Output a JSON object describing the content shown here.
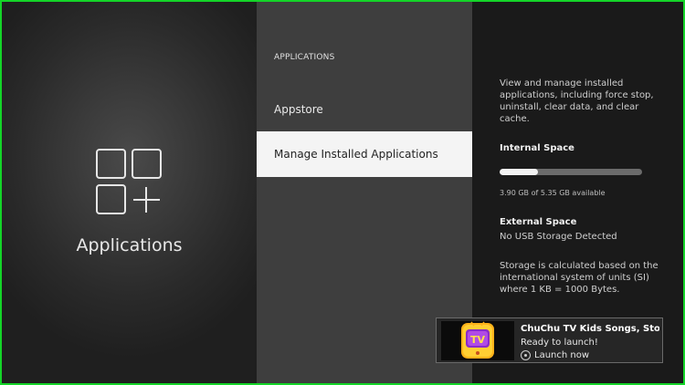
{
  "left_pane": {
    "icon": "apps-grid-plus-icon",
    "title": "Applications"
  },
  "middle_pane": {
    "section_header": "APPLICATIONS",
    "items": [
      {
        "label": "Appstore",
        "selected": false
      },
      {
        "label": "Manage Installed Applications",
        "selected": true
      }
    ]
  },
  "right_pane": {
    "description": "View and manage installed applications, including force stop, uninstall, clear data, and clear cache.",
    "internal_space": {
      "label": "Internal Space",
      "used_fraction": 0.27,
      "available_text": "3.90 GB of 5.35 GB available"
    },
    "external_space": {
      "label": "External Space",
      "value": "No USB Storage Detected"
    },
    "note": "Storage is calculated based on the international system of units (SI) where 1 KB = 1000 Bytes."
  },
  "toast": {
    "thumbnail_icon": "chuchu-tv-app-icon",
    "title": "ChuChu TV Kids Songs, Stories",
    "status": "Ready to launch!",
    "action_icon": "select-button-icon",
    "action_label": "Launch now"
  },
  "colors": {
    "frame_border": "#14d428",
    "selected_item_bg": "#f4f4f4",
    "middle_bg": "#3e3e3e",
    "right_bg": "#1a1a1a"
  }
}
